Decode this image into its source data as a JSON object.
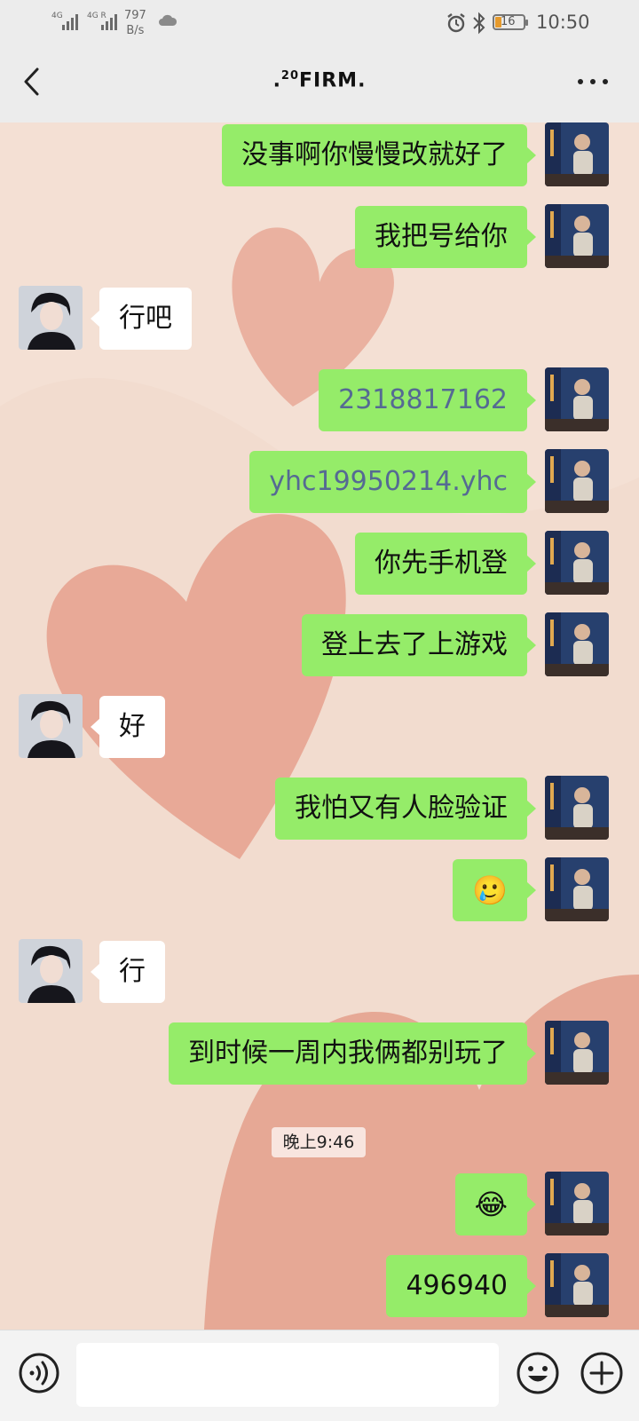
{
  "status_bar": {
    "signal_1": "4G",
    "signal_2": "4G R",
    "net_speed_value": "797",
    "net_speed_unit": "B/s",
    "battery": "16",
    "time": "10:50"
  },
  "nav": {
    "title_prefix": ".",
    "title_sup": "20",
    "title_main": "FIRM."
  },
  "messages": [
    {
      "side": "sent",
      "text": "没事啊你慢慢改就好了"
    },
    {
      "side": "sent",
      "text": "我把号给你"
    },
    {
      "side": "recv",
      "text": "行吧"
    },
    {
      "side": "sent",
      "text": "2318817162"
    },
    {
      "side": "sent",
      "text": "yhc19950214.yhc"
    },
    {
      "side": "sent",
      "text": "你先手机登"
    },
    {
      "side": "sent",
      "text": "登上去了上游戏"
    },
    {
      "side": "recv",
      "text": "好"
    },
    {
      "side": "sent",
      "text": "我怕又有人脸验证"
    },
    {
      "side": "sent",
      "text": "🥲"
    },
    {
      "side": "recv",
      "text": "行"
    },
    {
      "side": "sent",
      "text": "到时候一周内我俩都别玩了"
    },
    {
      "side": "sent",
      "text": "😂"
    },
    {
      "side": "sent",
      "text": "496940"
    }
  ],
  "timestamp": "晚上9:46",
  "input": {
    "value": ""
  },
  "icons": {
    "back": "back-arrow-icon",
    "more": "more-dots-icon",
    "voice": "voice-icon",
    "emoji": "emoji-icon",
    "plus": "plus-icon"
  },
  "colors": {
    "sent_bubble": "#95ec69",
    "recv_bubble": "#ffffff",
    "link_text": "#556a93"
  }
}
